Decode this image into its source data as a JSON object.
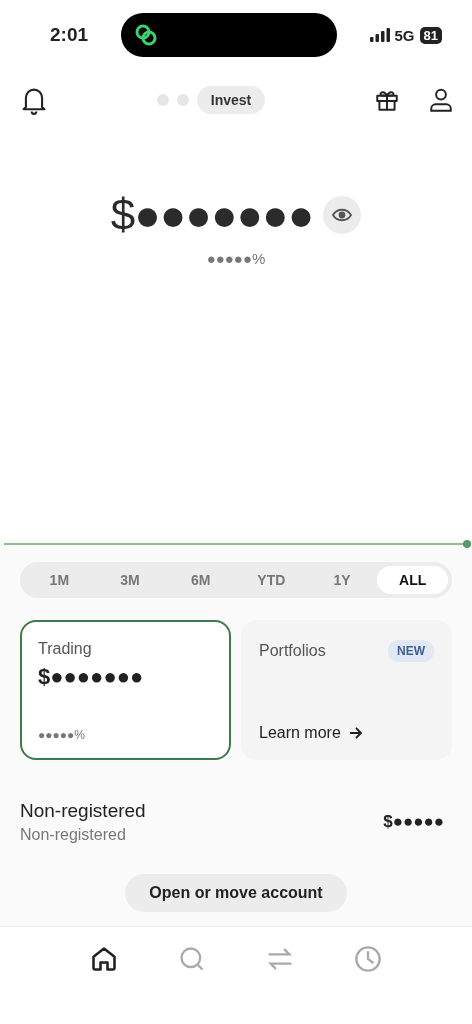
{
  "status_bar": {
    "time": "2:01",
    "network": "5G",
    "battery": "81"
  },
  "header": {
    "pages": [
      {
        "kind": "dot",
        "selected": false
      },
      {
        "kind": "dot",
        "selected": false
      },
      {
        "kind": "label",
        "label": "Invest",
        "selected": true
      }
    ]
  },
  "balance": {
    "amount": "$●●●●●●●",
    "change": "●●●●●%"
  },
  "periods": [
    {
      "label": "1M",
      "selected": false
    },
    {
      "label": "3M",
      "selected": false
    },
    {
      "label": "6M",
      "selected": false
    },
    {
      "label": "YTD",
      "selected": false
    },
    {
      "label": "1Y",
      "selected": false
    },
    {
      "label": "ALL",
      "selected": true
    }
  ],
  "cards": [
    {
      "kind": "account",
      "title": "Trading",
      "amount": "$●●●●●●●",
      "change": "●●●●●%",
      "selected": true
    },
    {
      "kind": "promo",
      "title": "Portfolios",
      "badge": "NEW",
      "link": "Learn more"
    }
  ],
  "account_row": {
    "title": "Non-registered",
    "subtitle": "Non-registered",
    "amount": "$●●●●●"
  },
  "action_button": "Open or move account",
  "nav": [
    {
      "kind": "home",
      "selected": true
    },
    {
      "kind": "search",
      "selected": false
    },
    {
      "kind": "transfer",
      "selected": false
    },
    {
      "kind": "history",
      "selected": false
    }
  ]
}
